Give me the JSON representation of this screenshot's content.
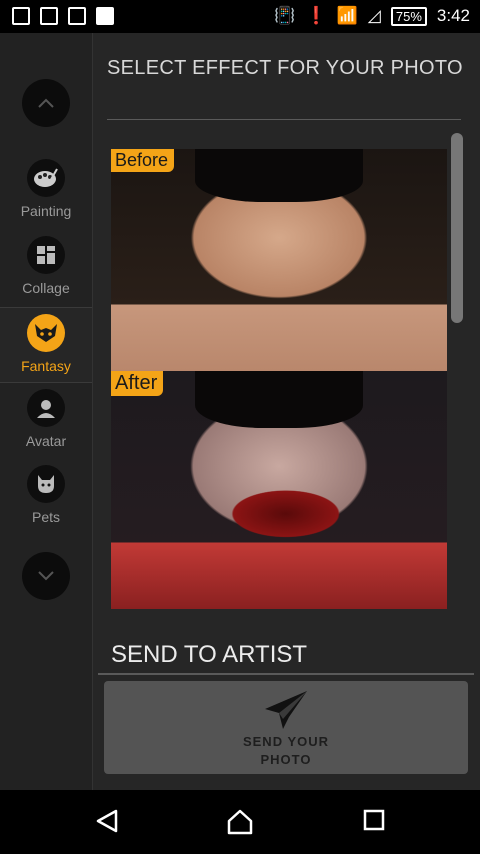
{
  "status_bar": {
    "battery": "75%",
    "time": "3:42"
  },
  "sidebar": {
    "items": [
      {
        "label": "Painting",
        "icon": "palette-icon"
      },
      {
        "label": "Collage",
        "icon": "collage-icon"
      },
      {
        "label": "Fantasy",
        "icon": "fantasy-mask-icon",
        "active": true
      },
      {
        "label": "Avatar",
        "icon": "avatar-icon"
      },
      {
        "label": "Pets",
        "icon": "cat-icon"
      }
    ]
  },
  "main": {
    "title": "SELECT EFFECT FOR YOUR PHOTO",
    "before_label": "Before",
    "after_label": "After",
    "send_section_title": "SEND TO ARTIST",
    "send_button": {
      "line1": "SEND YOUR",
      "line2": "PHOTO"
    }
  },
  "colors": {
    "accent": "#f4a417",
    "background": "#262626"
  }
}
